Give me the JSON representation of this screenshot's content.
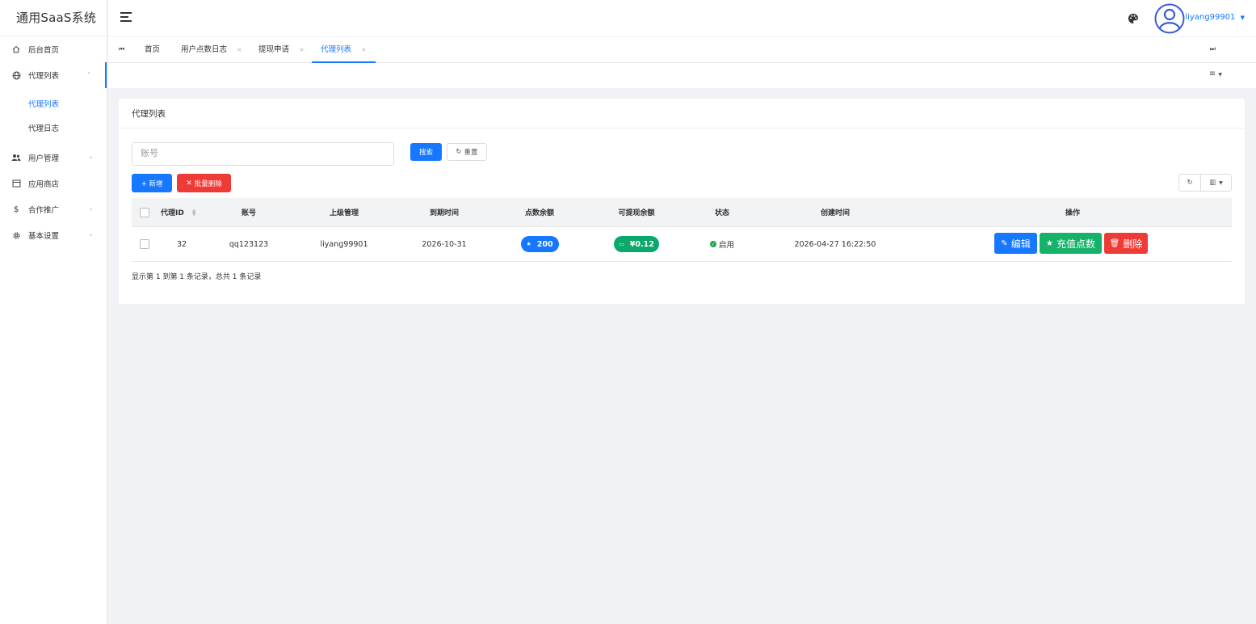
{
  "app": {
    "title": "通用SaaS系统"
  },
  "sidebar": {
    "items": [
      {
        "label": "后台首页",
        "icon": "home-icon"
      },
      {
        "label": "代理列表",
        "icon": "globe-icon"
      },
      {
        "label": "用户管理",
        "icon": "users-icon"
      },
      {
        "label": "应用商店",
        "icon": "store-icon"
      },
      {
        "label": "合作推广",
        "icon": "dollar-icon"
      },
      {
        "label": "基本设置",
        "icon": "gear-icon"
      }
    ],
    "sub_items": [
      {
        "label": "代理列表"
      },
      {
        "label": "代理日志"
      }
    ]
  },
  "header": {
    "username": "liyang99901"
  },
  "tabs": [
    {
      "label": "首页"
    },
    {
      "label": "用户点数日志"
    },
    {
      "label": "提现申请"
    },
    {
      "label": "代理列表"
    }
  ],
  "page": {
    "title": "代理列表",
    "search": {
      "placeholder": "账号",
      "search_label": "搜索",
      "reset_label": "重置"
    },
    "toolbar": {
      "add_label": "+ 新增",
      "batch_delete_label": "批量删除"
    },
    "table": {
      "columns": [
        "代理ID",
        "账号",
        "上级管理",
        "到期时间",
        "点数余额",
        "可提现余额",
        "状态",
        "创建时间",
        "操作"
      ],
      "rows": [
        {
          "id": "32",
          "account": "qq123123",
          "parent": "liyang99901",
          "expire": "2026-10-31",
          "points": "200",
          "withdrawable": "¥0.12",
          "status": "启用",
          "created": "2026-04-27 16:22:50",
          "actions": {
            "edit": "编辑",
            "recharge": "充值点数",
            "delete": "删除"
          }
        }
      ]
    },
    "pagination_text": "显示第 1 到第 1 条记录，总共 1 条记录"
  },
  "colors": {
    "primary": "#1677ff",
    "danger": "#ef3b35",
    "success": "#17b26a"
  }
}
